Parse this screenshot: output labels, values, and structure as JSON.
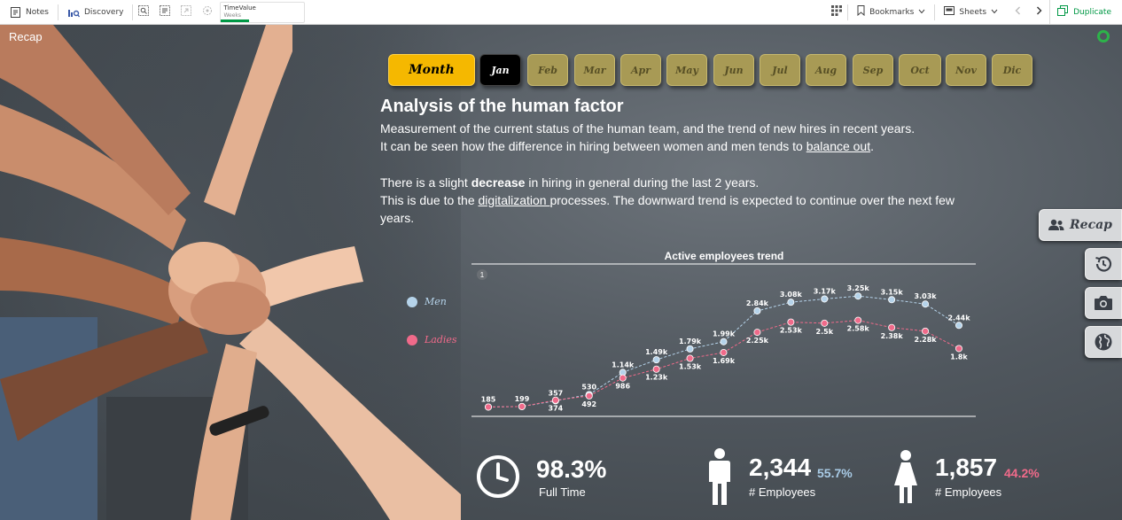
{
  "toolbar": {
    "notes": "Notes",
    "discovery": "Discovery",
    "selection": {
      "field": "TimeValue",
      "value": "Weeks"
    },
    "bookmarks": "Bookmarks",
    "sheets": "Sheets",
    "duplicate": "Duplicate",
    "accent": "#009845"
  },
  "sheet": {
    "title": "Recap"
  },
  "months": {
    "main": "Month",
    "items": [
      "Jan",
      "Feb",
      "Mar",
      "Apr",
      "May",
      "Jun",
      "Jul",
      "Aug",
      "Sep",
      "Oct",
      "Nov",
      "Dic"
    ],
    "selected": "Jan"
  },
  "narrative": {
    "heading": "Analysis of the human factor",
    "p1_line1": "Measurement of the current status of the human team, and the trend of new hires in recent years.",
    "p1_line2_pre": "It can be seen how the difference in hiring between women and men tends to ",
    "p1_line2_link": "balance out",
    "p1_line2_post": ".",
    "p2_line1_pre": "There is a slight ",
    "p2_line1_bold": "decrease",
    "p2_line1_post": " in hiring in general during the last 2 years.",
    "p2_line2_pre": "This is due to the ",
    "p2_line2_link": "digitalization ",
    "p2_line2_post": "processes. The downward trend is expected to continue over the next few",
    "p2_line3": "years."
  },
  "chart_data": {
    "type": "line",
    "title": "Active employees trend",
    "badge": "1",
    "legend_placement": "left",
    "series": [
      {
        "name": "Men",
        "color": "#b5d3ea",
        "values": [
          185,
          199,
          357,
          530,
          1140,
          1490,
          1790,
          1990,
          2840,
          3080,
          3170,
          3250,
          3150,
          3030,
          2440
        ],
        "labels": [
          "185",
          "199",
          "357",
          "530",
          "1.14k",
          "1.49k",
          "1.79k",
          "1.99k",
          "2.84k",
          "3.08k",
          "3.17k",
          "3.25k",
          "3.15k",
          "3.03k",
          "2.44k"
        ]
      },
      {
        "name": "Ladies",
        "color": "#f06a8a",
        "values": [
          185,
          199,
          374,
          492,
          986,
          1230,
          1530,
          1690,
          2250,
          2530,
          2500,
          2580,
          2380,
          2280,
          1800
        ],
        "labels": [
          "",
          "",
          "374",
          "492",
          "986",
          "1.23k",
          "1.53k",
          "1.69k",
          "2.25k",
          "2.53k",
          "2.5k",
          "2.58k",
          "2.38k",
          "2.28k",
          "1.8k"
        ]
      }
    ]
  },
  "kpis": {
    "fulltime": {
      "value": "98.3%",
      "label": "Full Time"
    },
    "men": {
      "value": "2,344",
      "pct": "55.7%",
      "label": "# Employees",
      "pct_color": "#a9cbe6"
    },
    "women": {
      "value": "1,857",
      "pct": "44.2%",
      "label": "# Employees",
      "pct_color": "#f06a8a"
    }
  },
  "nav": {
    "recap": "Recap"
  }
}
